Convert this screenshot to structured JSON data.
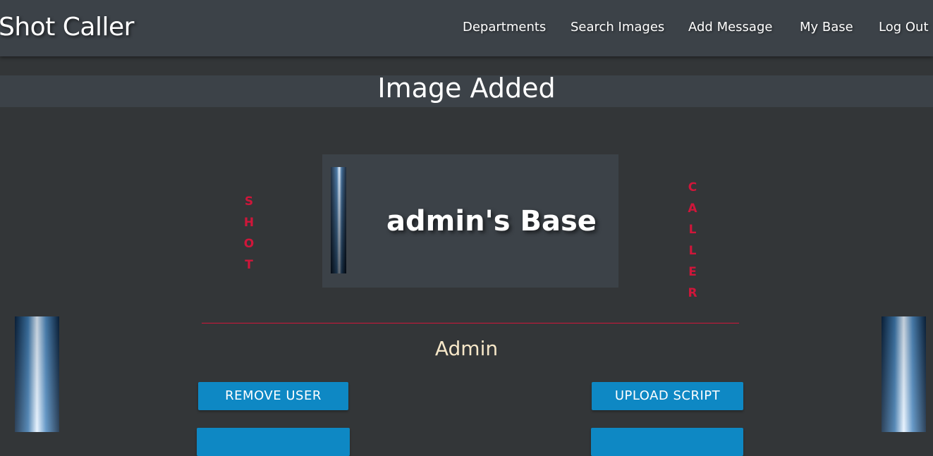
{
  "navbar": {
    "brand": "Shot Caller",
    "links": [
      "Departments",
      "Search Images",
      "Add Message",
      "My Base",
      "Log Out"
    ]
  },
  "banner": {
    "message": "Image Added"
  },
  "decor": {
    "left_word": [
      "S",
      "H",
      "O",
      "T"
    ],
    "right_word": [
      "C",
      "A",
      "L",
      "L",
      "E",
      "R"
    ]
  },
  "base": {
    "title": "admin's Base",
    "role": "Admin"
  },
  "actions": {
    "remove_user": "REMOVE USER",
    "upload_script": "UPLOAD SCRIPT"
  },
  "colors": {
    "accent": "#d0163a",
    "button": "#0e88c4",
    "navbar": "#3c4248",
    "background": "#333638",
    "role_text": "#f6e7c8"
  }
}
